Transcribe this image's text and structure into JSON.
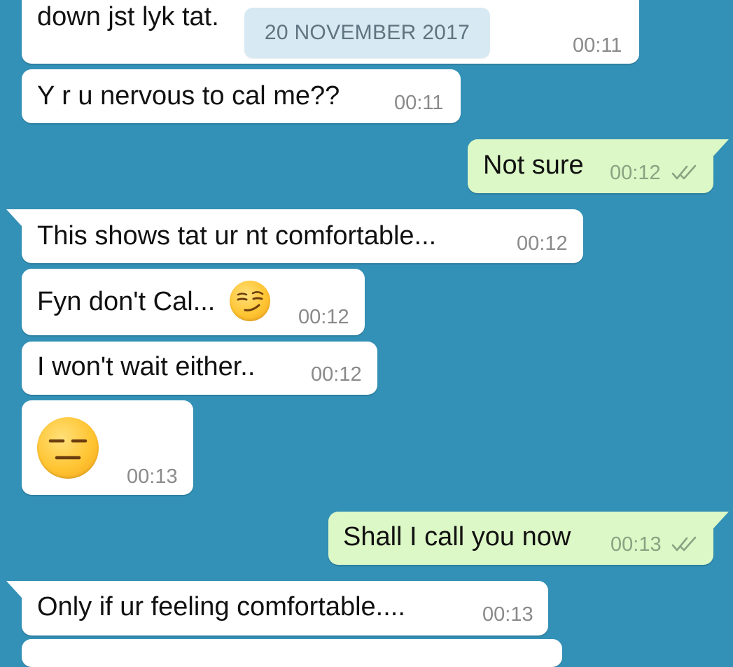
{
  "date_divider": "20 NOVEMBER 2017",
  "colors": {
    "background": "#3390b6",
    "incoming_bubble": "#ffffff",
    "outgoing_bubble": "#dcf8c6",
    "date_chip": "#d7e9f2"
  },
  "messages": [
    {
      "direction": "incoming",
      "text": "down jst lyk tat.",
      "time": "00:11"
    },
    {
      "direction": "incoming",
      "text": "Y r u nervous to cal me??",
      "time": "00:11"
    },
    {
      "direction": "outgoing",
      "text": "Not sure",
      "time": "00:12",
      "status_icon": "double-check-icon"
    },
    {
      "direction": "incoming",
      "text": "This shows tat ur nt comfortable...",
      "time": "00:12"
    },
    {
      "direction": "incoming",
      "text": "Fyn don't Cal...",
      "emoji": "smirking-face-emoji",
      "time": "00:12"
    },
    {
      "direction": "incoming",
      "text": "I won't wait either..",
      "time": "00:12"
    },
    {
      "direction": "incoming",
      "emoji": "expressionless-face-emoji",
      "time": "00:13"
    },
    {
      "direction": "outgoing",
      "text": "Shall I call you now",
      "time": "00:13",
      "status_icon": "double-check-icon"
    },
    {
      "direction": "incoming",
      "text": "Only if ur feeling comfortable....",
      "time": "00:13"
    }
  ]
}
